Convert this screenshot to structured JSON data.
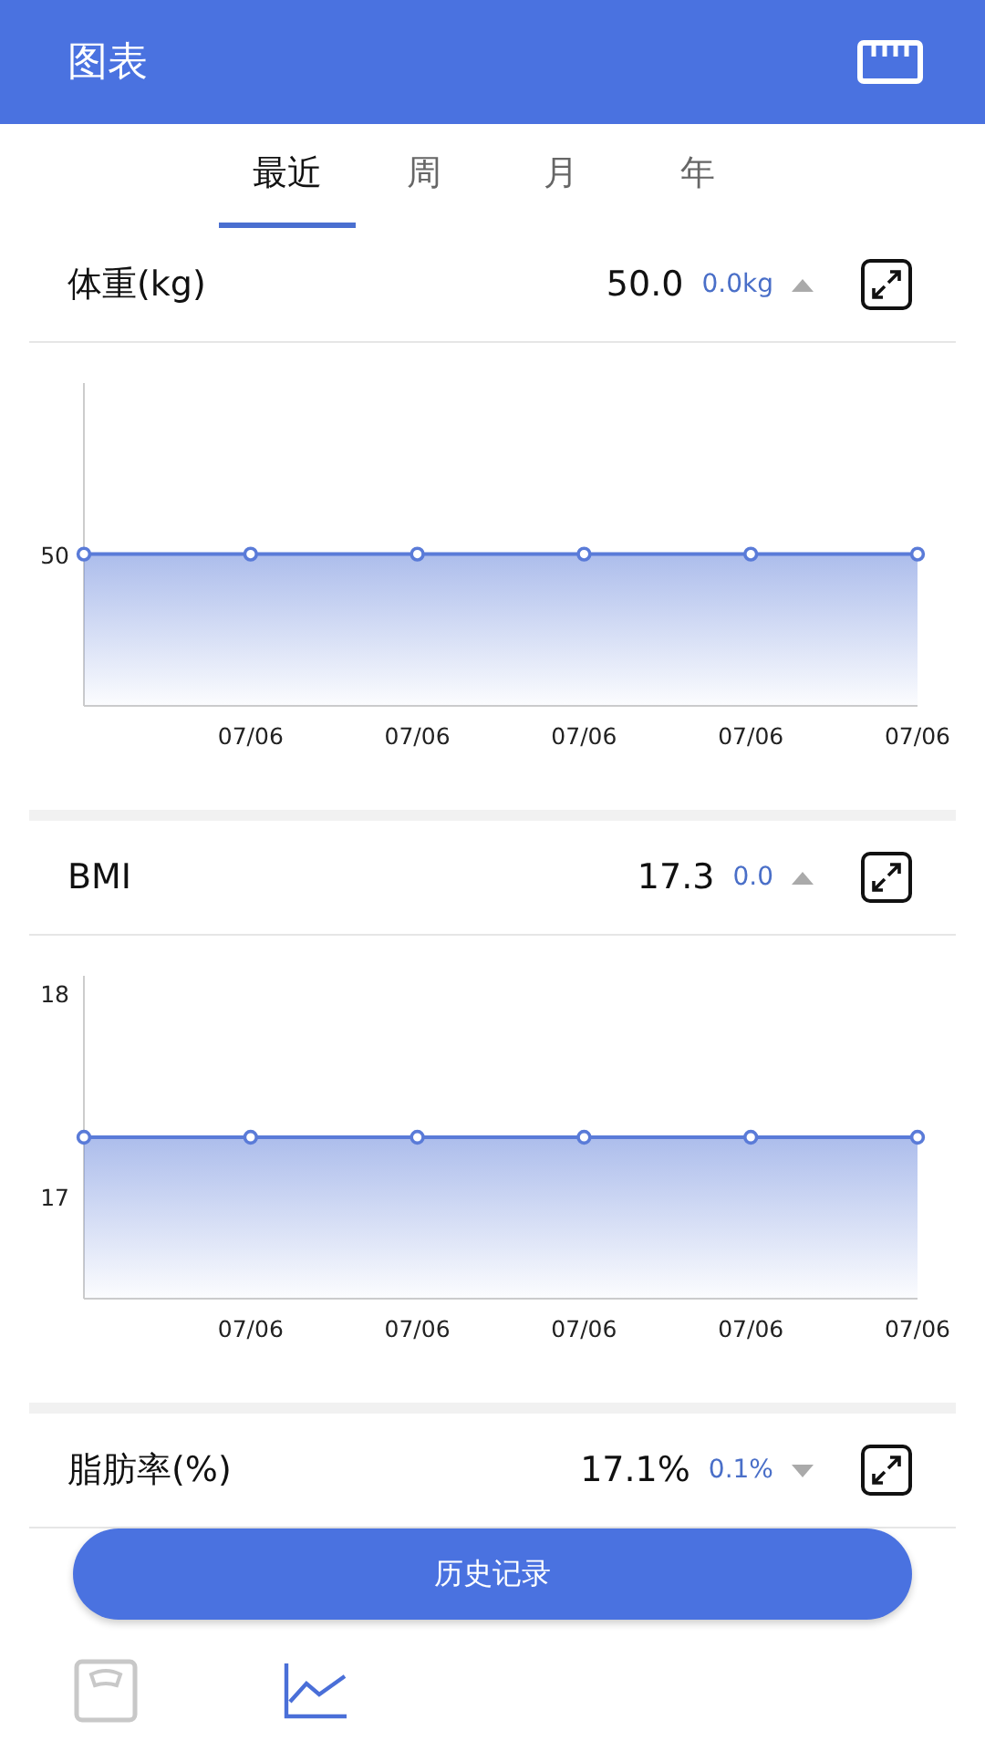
{
  "app_bar": {
    "title": "图表"
  },
  "tabs": [
    {
      "label": "最近",
      "selected": true
    },
    {
      "label": "周",
      "selected": false
    },
    {
      "label": "月",
      "selected": false
    },
    {
      "label": "年",
      "selected": false
    }
  ],
  "metrics": [
    {
      "title": "体重(kg)",
      "value": "50.0",
      "change": "0.0kg",
      "rising": true,
      "chart_picture": {
        "y_labels": [
          "50"
        ],
        "x_labels": [
          "07/06",
          "07/06",
          "07/06",
          "07/06",
          "07/06"
        ]
      }
    },
    {
      "title": "BMI",
      "value": "17.3",
      "change": "0.0",
      "rising": true,
      "chart_picture": {
        "y_labels": [
          "18",
          "17"
        ],
        "x_labels": [
          "07/06",
          "07/06",
          "07/06",
          "07/06",
          "07/06"
        ]
      }
    },
    {
      "title": "脂肪率(%)",
      "value": "17.1%",
      "change": "0.1%",
      "rising": false
    }
  ],
  "history_button": {
    "label": "历史记录"
  },
  "bottom_nav": [
    {
      "kind": "scale",
      "selected": false
    },
    {
      "kind": "chart",
      "selected": true
    }
  ]
}
